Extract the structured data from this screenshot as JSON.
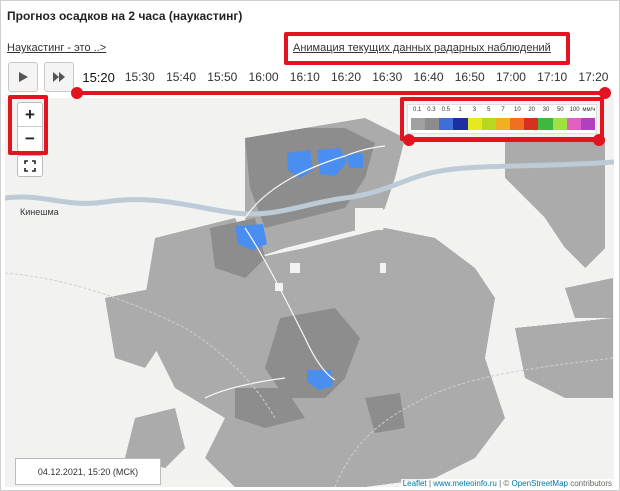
{
  "title": "Прогноз осадков на 2 часа (наукастинг)",
  "links": {
    "nowcasting": "Наукастинг - это ..>",
    "animation": "Анимация текущих данных радарных наблюдений"
  },
  "controls": {
    "play_icon": "play-icon",
    "fast_forward_icon": "fast-forward-icon"
  },
  "timeline": {
    "times": [
      "15:20",
      "15:30",
      "15:40",
      "15:50",
      "16:00",
      "16:10",
      "16:20",
      "16:30",
      "16:40",
      "16:50",
      "17:00",
      "17:10",
      "17:20"
    ],
    "active": "15:20"
  },
  "map": {
    "zoom_in": "+",
    "zoom_out": "−",
    "fullscreen_icon": "fullscreen-icon",
    "city": "Кинешма",
    "date": "04.12.2021, 15:20 (МСК)",
    "attribution_leaflet": "Leaflet",
    "attribution_sep1": " | ",
    "attribution_meteo": "www.meteoinfo.ru",
    "attribution_sep2": " | © ",
    "attribution_osm": "OpenStreetMap",
    "attribution_tail": " contributors"
  },
  "legend": {
    "labels": [
      "0.1",
      "0.3",
      "0.5",
      "1",
      "3",
      "5",
      "7",
      "10",
      "20",
      "30",
      "50",
      "100",
      "мм/ч"
    ],
    "colors": [
      "#a0a0a0",
      "#8c8c8c",
      "#3f6fd6",
      "#1b2fa0",
      "#e8e820",
      "#b8d820",
      "#f0b020",
      "#f07020",
      "#d83020",
      "#40b840",
      "#a0e040",
      "#e060c0",
      "#b040c0"
    ]
  },
  "colors": {
    "highlight": "#e0151f",
    "precip_light": "#a8a8a8",
    "precip_medium": "#8a8a8a",
    "precip_blue": "#4a8ef0"
  }
}
